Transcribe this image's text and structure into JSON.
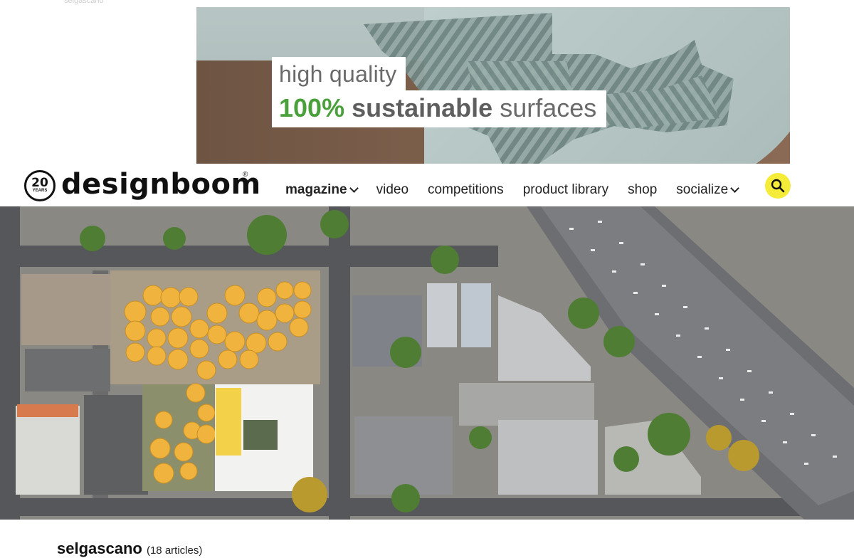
{
  "top_faded_text": "selgascano",
  "ad": {
    "line1": "high quality",
    "line2_green": "100%",
    "line2_bold": "sustainable",
    "line2_rest": "surfaces"
  },
  "logo": {
    "years_number": "20",
    "years_label": "YEARS",
    "wordmark": "designboom",
    "registered": "®"
  },
  "nav": {
    "items": [
      {
        "label": "magazine",
        "dropdown": true,
        "active": true
      },
      {
        "label": "video",
        "dropdown": false
      },
      {
        "label": "competitions",
        "dropdown": false
      },
      {
        "label": "product library",
        "dropdown": false
      },
      {
        "label": "shop",
        "dropdown": false
      },
      {
        "label": "socialize",
        "dropdown": true
      }
    ],
    "search_icon": "search-icon",
    "search_color": "#f5ec3a"
  },
  "tag": {
    "title": "selgascano",
    "count": "(18 articles)"
  },
  "colors": {
    "accent_green": "#4aa13c",
    "umbrella": "#f0b43e"
  }
}
